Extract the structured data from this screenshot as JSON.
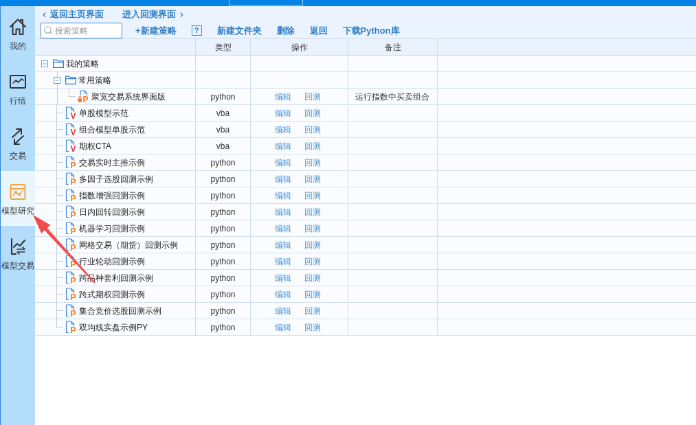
{
  "sidebar": {
    "items": [
      {
        "kind": "home",
        "label": "我的",
        "selected": false
      },
      {
        "kind": "market",
        "label": "行情",
        "selected": false
      },
      {
        "kind": "trade",
        "label": "交易",
        "selected": false
      },
      {
        "kind": "research",
        "label": "模型研究",
        "selected": true
      },
      {
        "kind": "model_trade",
        "label": "模型交易",
        "selected": false
      }
    ]
  },
  "nav": {
    "back": "返回主页界面",
    "forward": "进入回测界面"
  },
  "search": {
    "placeholder": "搜索策略"
  },
  "toolbar": [
    {
      "kind": "link",
      "label": "+新建策略"
    },
    {
      "kind": "help",
      "label": "?"
    },
    {
      "kind": "link",
      "label": "新建文件夹"
    },
    {
      "kind": "link",
      "label": "删除"
    },
    {
      "kind": "link",
      "label": "返回"
    },
    {
      "kind": "link",
      "label": "下载Python库"
    }
  ],
  "table": {
    "columns": [
      "类型",
      "操作",
      "备注"
    ],
    "rows": [
      {
        "kind": "folder",
        "name": "我的策略",
        "expanded": true,
        "children": [
          {
            "kind": "folder",
            "name": "常用策略",
            "expanded": true,
            "children": [
              {
                "kind": "python_file",
                "mark": "P",
                "locked": true,
                "name": "聚宽交易系统界面版",
                "type": "python",
                "actions": [
                  "编辑",
                  "回测"
                ],
                "note": "运行指数中买卖组合"
              }
            ]
          },
          {
            "kind": "vba_file",
            "mark": "V",
            "locked": false,
            "name": "单股模型示范",
            "type": "vba",
            "actions": [
              "编辑",
              "回测"
            ]
          },
          {
            "kind": "vba_file",
            "mark": "V",
            "locked": false,
            "name": "组合模型单股示范",
            "type": "vba",
            "actions": [
              "编辑",
              "回测"
            ]
          },
          {
            "kind": "vba_file",
            "mark": "V",
            "locked": false,
            "name": "期权CTA",
            "type": "vba",
            "actions": [
              "编辑",
              "回测"
            ]
          },
          {
            "kind": "python_file",
            "mark": "P",
            "locked": false,
            "name": "交易实时主推示例",
            "type": "python",
            "actions": [
              "编辑",
              "回测"
            ]
          },
          {
            "kind": "python_file",
            "mark": "P",
            "locked": false,
            "name": "多因子选股回测示例",
            "type": "python",
            "actions": [
              "编辑",
              "回测"
            ]
          },
          {
            "kind": "python_file",
            "mark": "P",
            "locked": false,
            "name": "指数增强回测示例",
            "type": "python",
            "actions": [
              "编辑",
              "回测"
            ]
          },
          {
            "kind": "python_file",
            "mark": "P",
            "locked": false,
            "name": "日内回转回测示例",
            "type": "python",
            "actions": [
              "编辑",
              "回测"
            ]
          },
          {
            "kind": "python_file",
            "mark": "P",
            "locked": false,
            "name": "机器学习回测示例",
            "type": "python",
            "actions": [
              "编辑",
              "回测"
            ]
          },
          {
            "kind": "python_file",
            "mark": "P",
            "locked": false,
            "name": "网格交易（期货）回测示例",
            "type": "python",
            "actions": [
              "编辑",
              "回测"
            ]
          },
          {
            "kind": "python_file",
            "mark": "P",
            "locked": false,
            "name": "行业轮动回测示例",
            "type": "python",
            "actions": [
              "编辑",
              "回测"
            ]
          },
          {
            "kind": "python_file",
            "mark": "P",
            "locked": false,
            "name": "跨品种套利回测示例",
            "type": "python",
            "actions": [
              "编辑",
              "回测"
            ]
          },
          {
            "kind": "python_file",
            "mark": "P",
            "locked": false,
            "name": "跨式期权回测示例",
            "type": "python",
            "actions": [
              "编辑",
              "回测"
            ]
          },
          {
            "kind": "python_file",
            "mark": "P",
            "locked": false,
            "name": "集合竞价选股回测示例",
            "type": "python",
            "actions": [
              "编辑",
              "回测"
            ]
          },
          {
            "kind": "python_file",
            "mark": "P",
            "locked": false,
            "name": "双均线实盘示例PY",
            "type": "python",
            "actions": [
              "编辑",
              "回测"
            ]
          }
        ]
      }
    ]
  }
}
